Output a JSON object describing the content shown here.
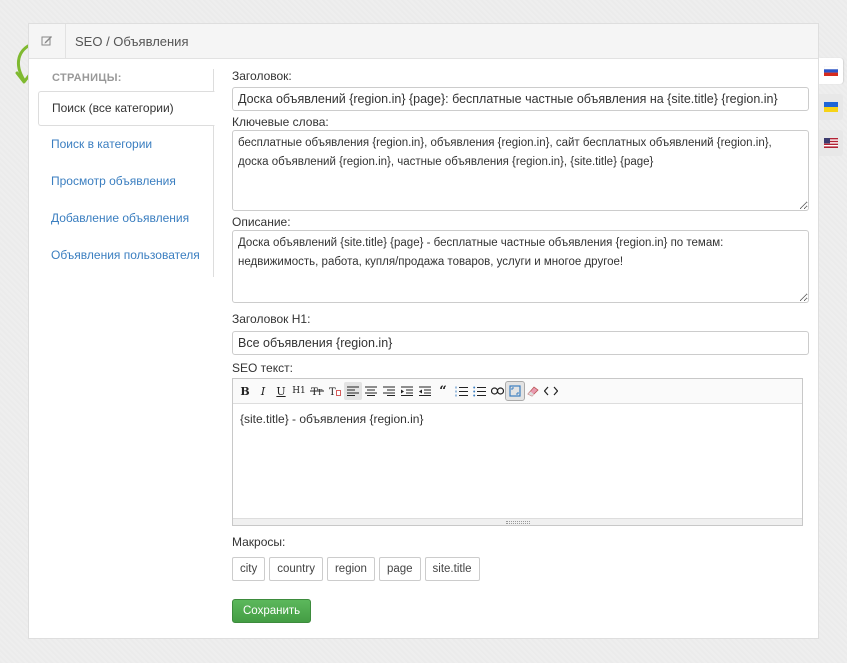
{
  "header": {
    "title": "SEO / Объявления",
    "icon": "edit-icon"
  },
  "sidebar": {
    "title": "СТРАНИЦЫ:",
    "items": [
      {
        "label": "Поиск (все категории)",
        "active": true
      },
      {
        "label": "Поиск в категории"
      },
      {
        "label": "Просмотр объявления"
      },
      {
        "label": "Добавление объявления"
      },
      {
        "label": "Объявления пользователя"
      }
    ]
  },
  "form": {
    "title_label": "Заголовок:",
    "title_value": "Доска объявлений {region.in} {page}: бесплатные частные объявления на {site.title} {region.in}",
    "keywords_label": "Ключевые слова:",
    "keywords_value": "бесплатные объявления {region.in}, объявления {region.in}, сайт бесплатных объявлений {region.in}, доска объявлений {region.in}, частные объявления {region.in}, {site.title} {page}",
    "description_label": "Описание:",
    "description_value": "Доска объявлений {site.title} {page} - бесплатные частные объявления {region.in} по темам: недвижимость, работа, купля/продажа товаров, услуги и многое другое!",
    "h1_label": "Заголовок H1:",
    "h1_value": "Все объявления {region.in}",
    "seo_text_label": "SEO текст:",
    "seo_text_value": "{site.title} - объявления {region.in}",
    "macros_label": "Макросы:",
    "macros": [
      "city",
      "country",
      "region",
      "page",
      "site.title"
    ],
    "save_label": "Сохранить"
  },
  "toolbar": {
    "buttons": [
      "bold",
      "italic",
      "underline",
      "heading",
      "strikethrough",
      "text-color",
      "align-left",
      "align-center",
      "align-right",
      "indent",
      "outdent",
      "blockquote",
      "ordered-list",
      "unordered-list",
      "link",
      "fullscreen",
      "eraser",
      "source-code"
    ],
    "glyphs": {
      "bold": "B",
      "italic": "I",
      "underline": "U",
      "heading": "H1",
      "quote": "“"
    }
  },
  "languages": [
    {
      "code": "ru",
      "active": true,
      "colors": [
        "#ffffff",
        "#2953c8",
        "#d52b1e"
      ]
    },
    {
      "code": "uk",
      "active": false,
      "colors": [
        "#1e66d8",
        "#f6d317"
      ]
    },
    {
      "code": "en",
      "active": false,
      "colors": [
        "#b22234",
        "#ffffff",
        "#3c3b6e"
      ]
    }
  ],
  "colors": {
    "link": "#3a7ec0",
    "save": "#5cb85c",
    "arrow": "#7fb930"
  }
}
